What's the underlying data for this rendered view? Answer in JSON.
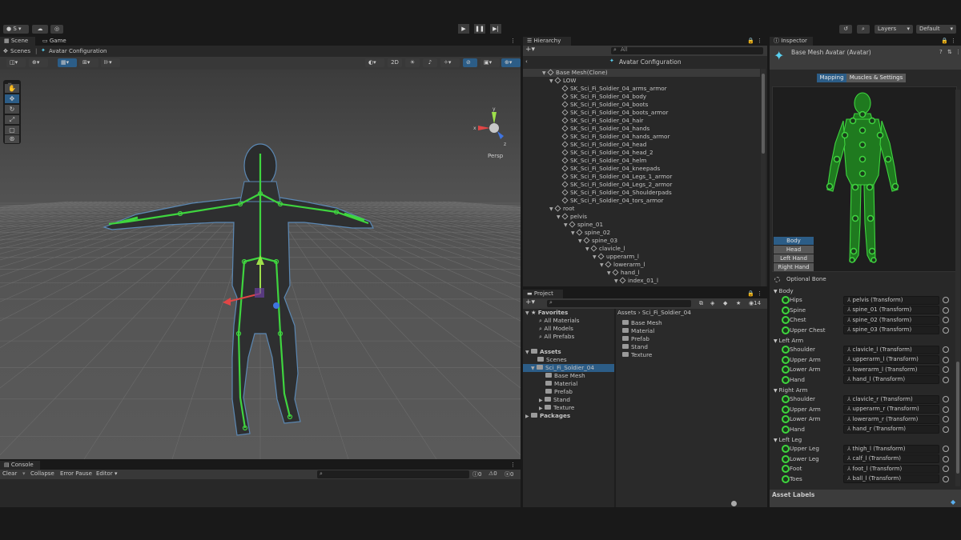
{
  "toolbar": {
    "account": "S",
    "layers": "Layers",
    "layout": "Default"
  },
  "scene_panel": {
    "tabs": [
      "Scene",
      "Game"
    ],
    "breadcrumb_root": "Scenes",
    "breadcrumb_current": "Avatar Configuration",
    "toggle_2d": "2D",
    "persp_label": "Persp"
  },
  "console": {
    "tab": "Console",
    "clear": "Clear",
    "collapse": "Collapse",
    "error_pause": "Error Pause",
    "editor": "Editor",
    "count_warn": "0",
    "count_err": "0",
    "count_info": "0"
  },
  "hierarchy": {
    "tab": "Hierarchy",
    "search_placeholder": "All",
    "scene_title": "Avatar Configuration",
    "items": [
      {
        "label": "Base Mesh(Clone)",
        "indent": 0,
        "arrow": "▼",
        "selected": true
      },
      {
        "label": "LOW",
        "indent": 1,
        "arrow": "▼"
      },
      {
        "label": "SK_Sci_Fi_Soldier_04_arms_armor",
        "indent": 2,
        "arrow": ""
      },
      {
        "label": "SK_Sci_Fi_Soldier_04_body",
        "indent": 2,
        "arrow": ""
      },
      {
        "label": "SK_Sci_Fi_Soldier_04_boots",
        "indent": 2,
        "arrow": ""
      },
      {
        "label": "SK_Sci_Fi_Soldier_04_boots_armor",
        "indent": 2,
        "arrow": ""
      },
      {
        "label": "SK_Sci_Fi_Soldier_04_hair",
        "indent": 2,
        "arrow": ""
      },
      {
        "label": "SK_Sci_Fi_Soldier_04_hands",
        "indent": 2,
        "arrow": ""
      },
      {
        "label": "SK_Sci_Fi_Soldier_04_hands_armor",
        "indent": 2,
        "arrow": ""
      },
      {
        "label": "SK_Sci_Fi_Soldier_04_head",
        "indent": 2,
        "arrow": ""
      },
      {
        "label": "SK_Sci_Fi_Soldier_04_head_2",
        "indent": 2,
        "arrow": ""
      },
      {
        "label": "SK_Sci_Fi_Soldier_04_helm",
        "indent": 2,
        "arrow": ""
      },
      {
        "label": "SK_Sci_Fi_Soldier_04_kneepads",
        "indent": 2,
        "arrow": ""
      },
      {
        "label": "SK_Sci_Fi_Soldier_04_Legs_1_armor",
        "indent": 2,
        "arrow": ""
      },
      {
        "label": "SK_Sci_Fi_Soldier_04_Legs_2_armor",
        "indent": 2,
        "arrow": ""
      },
      {
        "label": "SK_Sci_Fi_Soldier_04_Shoulderpads",
        "indent": 2,
        "arrow": ""
      },
      {
        "label": "SK_Sci_Fi_Soldier_04_tors_armor",
        "indent": 2,
        "arrow": ""
      },
      {
        "label": "root",
        "indent": 1,
        "arrow": "▼"
      },
      {
        "label": "pelvis",
        "indent": 2,
        "arrow": "▼"
      },
      {
        "label": "spine_01",
        "indent": 3,
        "arrow": "▼"
      },
      {
        "label": "spine_02",
        "indent": 4,
        "arrow": "▼"
      },
      {
        "label": "spine_03",
        "indent": 5,
        "arrow": "▼"
      },
      {
        "label": "clavicle_l",
        "indent": 6,
        "arrow": "▼"
      },
      {
        "label": "upperarm_l",
        "indent": 7,
        "arrow": "▼"
      },
      {
        "label": "lowerarm_l",
        "indent": 8,
        "arrow": "▼"
      },
      {
        "label": "hand_l",
        "indent": 9,
        "arrow": "▼"
      },
      {
        "label": "index_01_l",
        "indent": 10,
        "arrow": "▼"
      }
    ]
  },
  "project": {
    "tab": "Project",
    "count": "14",
    "favorites": {
      "label": "Favorites",
      "items": [
        "All Materials",
        "All Models",
        "All Prefabs"
      ]
    },
    "assets": {
      "label": "Assets",
      "scenes": "Scenes",
      "folder": "Sci_Fi_Soldier_04",
      "children": [
        "Base Mesh",
        "Material",
        "Prefab",
        "Stand",
        "Texture"
      ]
    },
    "packages": "Packages",
    "breadcrumb": [
      "Assets",
      "Sci_Fi_Soldier_04"
    ],
    "content": [
      "Base Mesh",
      "Material",
      "Prefab",
      "Stand",
      "Texture"
    ]
  },
  "inspector": {
    "tab": "Inspector",
    "title": "Base Mesh Avatar (Avatar)",
    "tabs": [
      "Mapping",
      "Muscles & Settings"
    ],
    "body_buttons": [
      "Body",
      "Head",
      "Left Hand",
      "Right Hand"
    ],
    "optional_bone": "Optional Bone",
    "asset_labels": "Asset Labels",
    "groups": [
      {
        "name": "Body",
        "bones": [
          {
            "name": "Hips",
            "value": "pelvis (Transform)"
          },
          {
            "name": "Spine",
            "value": "spine_01 (Transform)"
          },
          {
            "name": "Chest",
            "value": "spine_02 (Transform)"
          },
          {
            "name": "Upper Chest",
            "value": "spine_03 (Transform)"
          }
        ]
      },
      {
        "name": "Left Arm",
        "bones": [
          {
            "name": "Shoulder",
            "value": "clavicle_l (Transform)"
          },
          {
            "name": "Upper Arm",
            "value": "upperarm_l (Transform)"
          },
          {
            "name": "Lower Arm",
            "value": "lowerarm_l (Transform)"
          },
          {
            "name": "Hand",
            "value": "hand_l (Transform)"
          }
        ]
      },
      {
        "name": "Right Arm",
        "bones": [
          {
            "name": "Shoulder",
            "value": "clavicle_r (Transform)"
          },
          {
            "name": "Upper Arm",
            "value": "upperarm_r (Transform)"
          },
          {
            "name": "Lower Arm",
            "value": "lowerarm_r (Transform)"
          },
          {
            "name": "Hand",
            "value": "hand_r (Transform)"
          }
        ]
      },
      {
        "name": "Left Leg",
        "bones": [
          {
            "name": "Upper Leg",
            "value": "thigh_l (Transform)"
          },
          {
            "name": "Lower Leg",
            "value": "calf_l (Transform)"
          },
          {
            "name": "Foot",
            "value": "foot_l (Transform)"
          },
          {
            "name": "Toes",
            "value": "ball_l (Transform)"
          }
        ]
      }
    ]
  },
  "colors": {
    "accent": "#2c5d87",
    "bone_green": "#3fd53f"
  }
}
